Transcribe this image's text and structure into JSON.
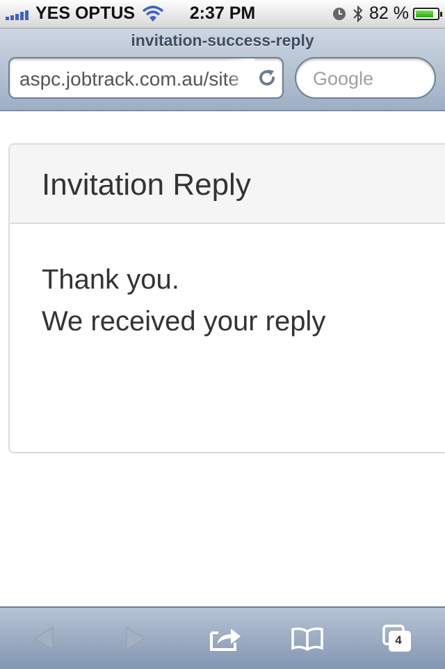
{
  "status_bar": {
    "carrier": "YES OPTUS",
    "time": "2:37 PM",
    "battery_percent": "82 %",
    "battery_level": 0.82,
    "icons": [
      "signal-bars-icon",
      "wifi-icon",
      "clock-icon",
      "bluetooth-icon",
      "battery-icon"
    ]
  },
  "browser": {
    "page_title": "invitation-success-reply",
    "url": "aspc.jobtrack.com.au/site",
    "search_placeholder": "Google",
    "tabs_count": "4",
    "colors": {
      "bar_top": "#cdd6e2",
      "bar_bottom": "#9eafc4"
    }
  },
  "card": {
    "title": "Invitation Reply",
    "line1": "Thank you.",
    "line2": "We received your reply"
  },
  "toolbar": {
    "buttons": [
      "back-icon",
      "forward-icon",
      "share-icon",
      "bookmarks-icon",
      "tabs-icon"
    ]
  }
}
